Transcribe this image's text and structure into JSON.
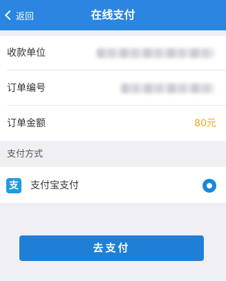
{
  "navbar": {
    "back_label": "返回",
    "title": "在线支付"
  },
  "order": {
    "payee_label": "收款单位",
    "order_no_label": "订单编号",
    "amount_label": "订单金额",
    "amount_value": "80元"
  },
  "payment": {
    "section_label": "支付方式",
    "method_label": "支付宝支付",
    "method_icon": "alipay-icon",
    "selected": true
  },
  "action": {
    "pay_button_label": "去支付"
  },
  "colors": {
    "primary": "#2a86e0",
    "amount": "#f0a81c",
    "background": "#efeff4"
  }
}
